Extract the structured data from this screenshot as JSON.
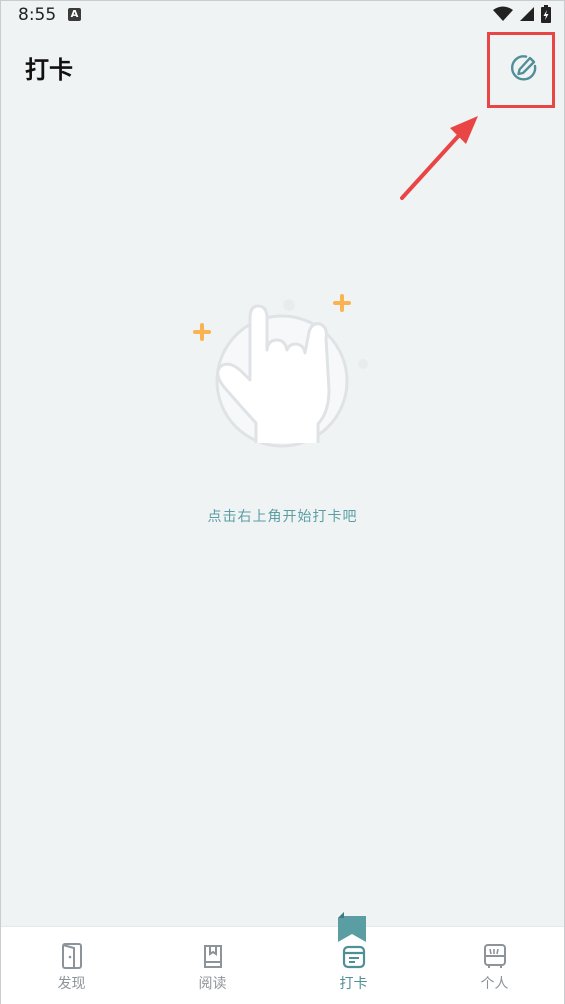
{
  "status_bar": {
    "time": "8:55",
    "notification_letter": "A"
  },
  "header": {
    "title": "打卡"
  },
  "empty_state": {
    "hint": "点击右上角开始打卡吧"
  },
  "tabs": [
    {
      "label": "发现",
      "icon": "door-icon",
      "active": false
    },
    {
      "label": "阅读",
      "icon": "book-icon",
      "active": false
    },
    {
      "label": "打卡",
      "icon": "calendar-icon",
      "active": true
    },
    {
      "label": "个人",
      "icon": "profile-icon",
      "active": false
    }
  ],
  "colors": {
    "accent": "#4f8f96",
    "background": "#f0f3f4",
    "highlight": "#e94545",
    "sparkle": "#f9b451",
    "tab_inactive": "#8d9499"
  }
}
